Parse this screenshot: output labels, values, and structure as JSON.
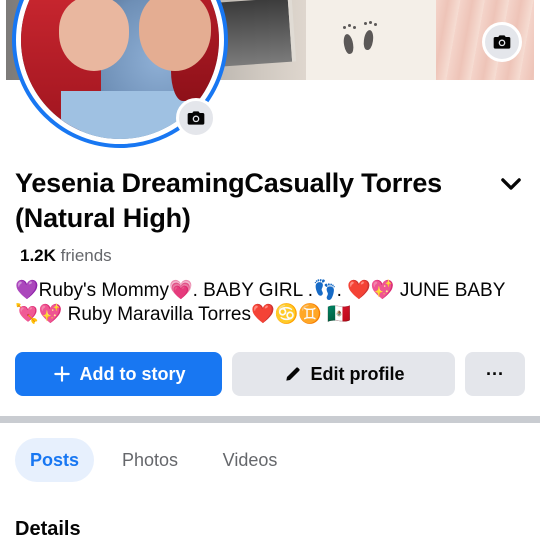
{
  "profile": {
    "name": "Yesenia DreamingCasually Torres (Natural High)",
    "friends_count": "1.2K",
    "friends_label": "friends",
    "bio": "💜Ruby's Mommy💗. BABY GIRL .👣. ❤️💖 JUNE BABY 💘💖 Ruby Maravilla Torres❤️♋♊ 🇲🇽"
  },
  "icons": {
    "cover_camera": "camera-icon",
    "avatar_camera": "camera-icon",
    "name_menu": "chevron-down-icon",
    "add_story": "plus-icon",
    "edit_profile": "pencil-icon",
    "more": "more-dots-icon"
  },
  "actions": {
    "add_story_label": "Add to story",
    "edit_profile_label": "Edit profile",
    "more_label": "···"
  },
  "tabs": [
    {
      "label": "Posts",
      "active": true
    },
    {
      "label": "Photos",
      "active": false
    },
    {
      "label": "Videos",
      "active": false
    }
  ],
  "sections": {
    "details_title": "Details"
  },
  "colors": {
    "accent": "#1877f2",
    "button_gray": "#e4e6eb",
    "active_tab_bg": "#e7f0fd",
    "secondary_text": "#65676b",
    "divider": "#c9ccd1"
  }
}
